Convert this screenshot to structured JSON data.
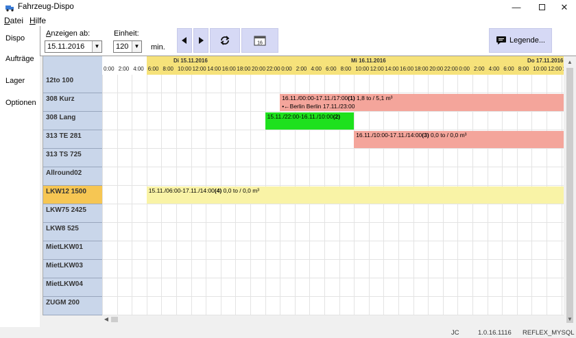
{
  "window": {
    "title": "Fahrzeug-Dispo"
  },
  "menu": {
    "file": "Datei",
    "help": "Hilfe"
  },
  "sidebar": {
    "tabs": [
      "Dispo",
      "Aufträge",
      "Lager",
      "Optionen"
    ]
  },
  "toolbar": {
    "show_from_label": "Anzeigen ab:",
    "show_from_value": "15.11.2016",
    "unit_label": "Einheit:",
    "unit_value": "120",
    "unit_suffix": "min.",
    "legend_label": "Legende..."
  },
  "gantt": {
    "days": [
      {
        "label": "Di 15.11.2016"
      },
      {
        "label": "Mi 16.11.2016"
      },
      {
        "label": "Do 17.11.2016"
      }
    ],
    "pre_times": [
      "0:00",
      "2:00",
      "4:00"
    ],
    "day_times": [
      "6:00",
      "8:00",
      "10:00",
      "12:00",
      "14:00",
      "16:00",
      "18:00",
      "20:00",
      "22:00",
      "0:00",
      "2:00",
      "4:00",
      "6:00",
      "8:00",
      "10:00",
      "12:00",
      "14:00",
      "16:00",
      "18:00",
      "20:00",
      "22:00",
      "0:00",
      "2:00",
      "4:00",
      "6:00",
      "8:00",
      "10:00",
      "12:00",
      "14:00"
    ],
    "rows": [
      "12to 100",
      "308 Kurz",
      "308 Lang",
      "313 TE 281",
      "313 TS 725",
      "Allround02",
      "LKW12 1500",
      "LKW75 2425",
      "LKW8 525",
      "MietLKW01",
      "MietLKW03",
      "MietLKW04",
      "ZUGM 200"
    ],
    "selected_row": "LKW12 1500",
    "bars": [
      {
        "row": "308 Kurz",
        "text": "16.11./00:00-17.11./17:00",
        "num": "(1)",
        "load": "1,8 to / 5,1 m³",
        "sub": "•←Berlin Berlin 17.11./23:00",
        "color": "#f4a59b"
      },
      {
        "row": "308 Lang",
        "text": "15.11./22:00-16.11./10:00",
        "num": "(2)",
        "load": "",
        "sub": "",
        "color": "#1ee11e"
      },
      {
        "row": "313 TE 281",
        "text": "16.11./10:00-17.11./14:00",
        "num": "(3)",
        "load": "0,0 to / 0,0 m³",
        "sub": "",
        "color": "#f4a59b"
      },
      {
        "row": "LKW12 1500",
        "text": "15.11./06:00-17.11./14:00",
        "num": "(4)",
        "load": "0,0 to / 0,0 m³",
        "sub": "",
        "color": "#f9f3a6"
      }
    ]
  },
  "status": {
    "user": "JC",
    "version": "1.0.16.1116",
    "db": "REFLEX_MYSQL"
  },
  "colors": {
    "day_header": "#f6e27a",
    "names_bg": "#c9d6ea",
    "selected": "#f6c653",
    "button_bg": "#d6d9f5"
  }
}
